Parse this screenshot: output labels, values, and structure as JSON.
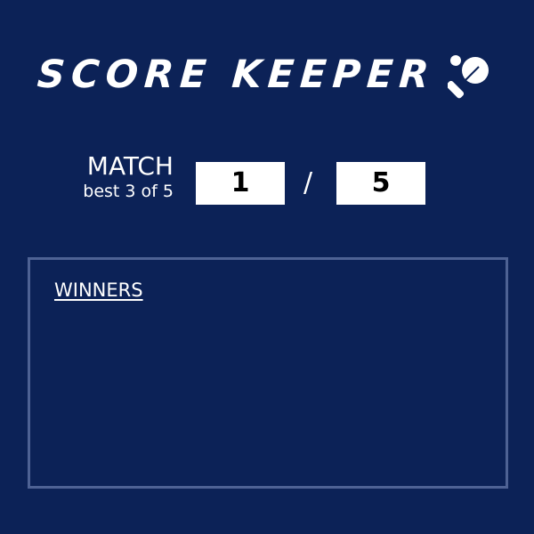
{
  "header": {
    "title": "SCORE KEEPER",
    "icon": "ping-pong-paddle-icon"
  },
  "match": {
    "label": "MATCH",
    "subtitle": "best 3 of 5",
    "current": "1",
    "separator": "/",
    "total": "5"
  },
  "winners": {
    "title": "WINNERS",
    "entries": []
  },
  "colors": {
    "background": "#0c2257",
    "panel_border": "#4e6294",
    "score_box": "#ffffff",
    "text": "#ffffff"
  }
}
